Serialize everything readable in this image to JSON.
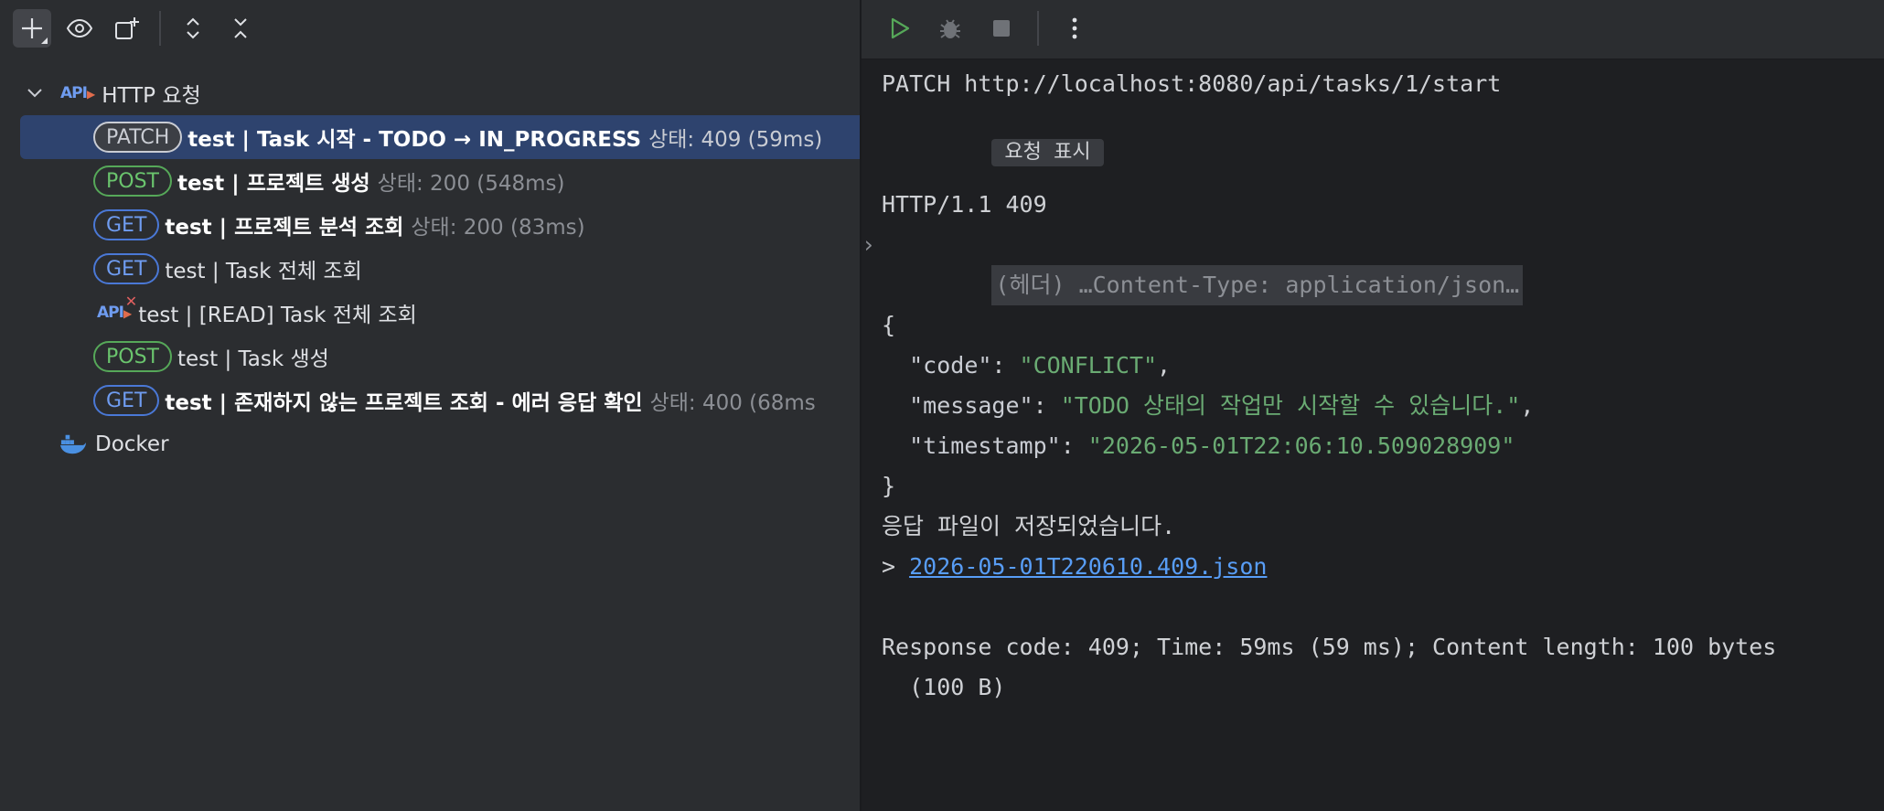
{
  "tree": {
    "root_label": "HTTP 요청",
    "items": [
      {
        "method": "PATCH",
        "name": "test  |  Task 시작 - TODO → IN_PROGRESS",
        "status": "상태: 409 (59ms)"
      },
      {
        "method": "POST",
        "name": "test  |  프로젝트 생성",
        "status": "상태: 200 (548ms)"
      },
      {
        "method": "GET",
        "name": "test  |  프로젝트 분석 조회",
        "status": "상태: 200 (83ms)"
      },
      {
        "method": "GET",
        "name": "test  |  Task 전체 조회",
        "status": ""
      },
      {
        "method": "",
        "name": "test | [READ] Task 전체 조회",
        "status": ""
      },
      {
        "method": "POST",
        "name": "test  |  Task 생성",
        "status": ""
      },
      {
        "method": "GET",
        "name": "test  |  존재하지 않는 프로젝트 조회 - 에러 응답 확인",
        "status": "상태: 400 (68ms"
      }
    ],
    "docker_label": "Docker"
  },
  "console": {
    "request_line": "PATCH http://localhost:8080/api/tasks/1/start",
    "show_request_chip": "요청 표시",
    "status_line": "HTTP/1.1 409",
    "headers_collapsed": "(헤더) …Content-Type: application/json…",
    "json_open": "{",
    "json_close": "}",
    "fields": [
      {
        "key": "\"code\"",
        "value": "\"CONFLICT\"",
        "trail": ","
      },
      {
        "key": "\"message\"",
        "value": "\"TODO 상태의 작업만 시작할 수 있습니다.\"",
        "trail": ","
      },
      {
        "key": "\"timestamp\"",
        "value": "\"2026-05-01T22:06:10.509028909\"",
        "trail": ""
      }
    ],
    "saved_msg": "응답 파일이 저장되었습니다.",
    "saved_prefix": "> ",
    "saved_file": "2026-05-01T220610.409.json",
    "summary_line1": "Response code: 409; Time: 59ms (59 ms); Content length: 100 bytes",
    "summary_line2": "(100 B)"
  },
  "icons": {
    "left_toolbar": [
      "plus-icon",
      "eye-icon",
      "new-tab-icon",
      "expand-all-icon",
      "collapse-all-icon"
    ],
    "right_toolbar": [
      "run-icon",
      "debug-icon",
      "stop-icon",
      "more-vertical-icon"
    ]
  },
  "colors": {
    "selection": "#2e436e",
    "patch": "#c9ccd3",
    "post": "#56a859",
    "get": "#4a78d6",
    "json_string": "#6aab73",
    "link": "#589df6"
  }
}
